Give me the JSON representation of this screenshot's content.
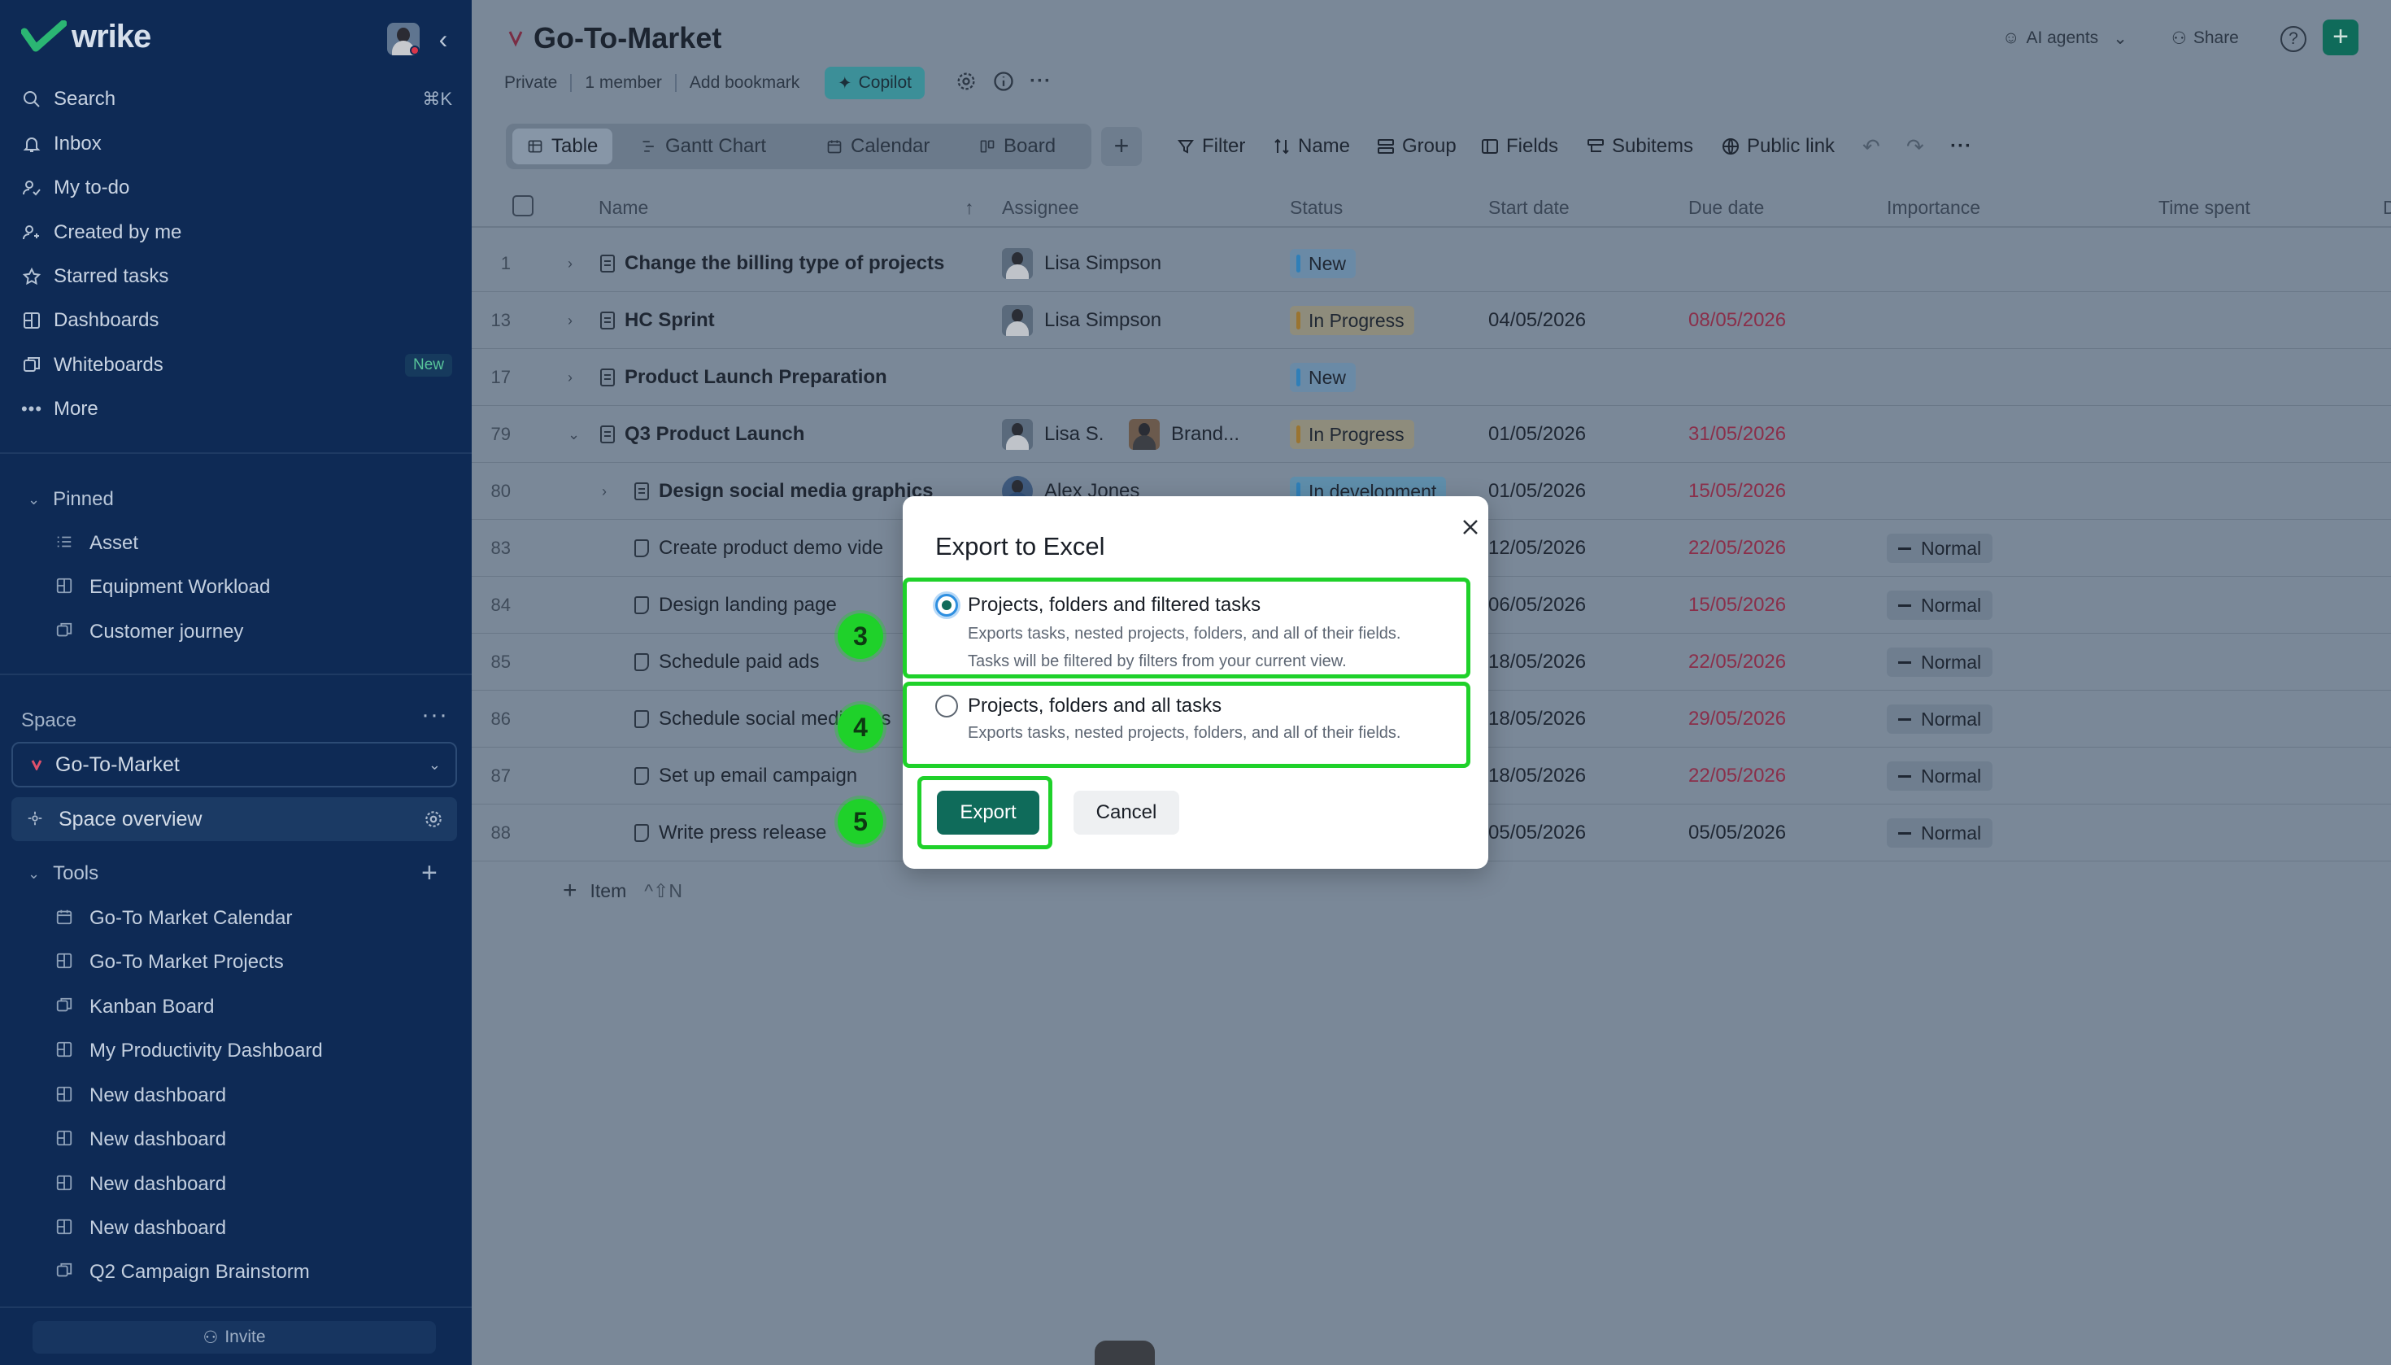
{
  "sidebar": {
    "logo": "wrike",
    "nav": [
      {
        "label": "Search",
        "shortcut": "⌘K",
        "icon": "search-icon"
      },
      {
        "label": "Inbox",
        "icon": "bell-icon"
      },
      {
        "label": "My to-do",
        "icon": "user-check-icon"
      },
      {
        "label": "Created by me",
        "icon": "user-plus-icon"
      },
      {
        "label": "Starred tasks",
        "icon": "star-icon"
      },
      {
        "label": "Dashboards",
        "icon": "dashboard-icon"
      },
      {
        "label": "Whiteboards",
        "badge": "New",
        "icon": "whiteboard-icon"
      },
      {
        "label": "More",
        "icon": "more-icon"
      }
    ],
    "pinned": {
      "label": "Pinned",
      "items": [
        {
          "label": "Asset",
          "icon": "list-icon"
        },
        {
          "label": "Equipment Workload",
          "icon": "dashboard-icon"
        },
        {
          "label": "Customer journey",
          "icon": "whiteboard-icon"
        }
      ]
    },
    "space": {
      "label": "Space",
      "selected": "Go-To-Market",
      "overview": "Space overview"
    },
    "tools": {
      "label": "Tools",
      "items": [
        {
          "label": "Go-To Market Calendar",
          "icon": "calendar-icon"
        },
        {
          "label": "Go-To Market Projects",
          "icon": "dashboard-icon"
        },
        {
          "label": "Kanban Board",
          "icon": "whiteboard-icon"
        },
        {
          "label": "My Productivity Dashboard",
          "icon": "dashboard-icon"
        },
        {
          "label": "New dashboard",
          "icon": "dashboard-icon"
        },
        {
          "label": "New dashboard",
          "icon": "dashboard-icon"
        },
        {
          "label": "New dashboard",
          "icon": "dashboard-icon"
        },
        {
          "label": "New dashboard",
          "icon": "dashboard-icon"
        },
        {
          "label": "Q2 Campaign Brainstorm",
          "icon": "whiteboard-icon"
        }
      ]
    },
    "invite": "Invite"
  },
  "header": {
    "title": "Go-To-Market",
    "meta": {
      "privacy": "Private",
      "members": "1 member",
      "bookmark": "Add bookmark"
    },
    "copilot": "Copilot",
    "ai_agents": "AI agents",
    "share": "Share",
    "help": "?"
  },
  "views": {
    "tabs": [
      "Table",
      "Gantt Chart",
      "Calendar",
      "Board"
    ],
    "active": "Table",
    "toolbar": {
      "filter": "Filter",
      "sort": "Name",
      "group": "Group",
      "fields": "Fields",
      "subitems": "Subitems",
      "public_link": "Public link"
    }
  },
  "table": {
    "columns": [
      "Name",
      "Assignee",
      "Status",
      "Start date",
      "Due date",
      "Importance",
      "Time spent",
      "D"
    ],
    "rows": [
      {
        "num": "1",
        "name": "Change the billing type of projects",
        "assignee": "Lisa Simpson",
        "status": "New",
        "start": "",
        "due": "",
        "importance": ""
      },
      {
        "num": "13",
        "name": "HC Sprint",
        "assignee": "Lisa Simpson",
        "status": "In Progress",
        "start": "04/05/2026",
        "due": "08/05/2026",
        "importance": ""
      },
      {
        "num": "17",
        "name": "Product Launch Preparation",
        "assignee": "",
        "status": "New",
        "start": "",
        "due": "",
        "importance": ""
      },
      {
        "num": "79",
        "name": "Q3 Product Launch",
        "assignee": "Lisa S.",
        "assignee2": "Brand...",
        "status": "In Progress",
        "start": "01/05/2026",
        "due": "31/05/2026",
        "importance": ""
      },
      {
        "num": "80",
        "name": "Design social media graphics",
        "assignee": "Alex Jones",
        "status": "In development",
        "start": "01/05/2026",
        "due": "15/05/2026",
        "importance": ""
      },
      {
        "num": "83",
        "name": "Create product demo vide",
        "start": "12/05/2026",
        "due": "22/05/2026",
        "importance": "Normal"
      },
      {
        "num": "84",
        "name": "Design landing page",
        "start": "06/05/2026",
        "due": "15/05/2026",
        "importance": "Normal"
      },
      {
        "num": "85",
        "name": "Schedule paid ads",
        "start": "18/05/2026",
        "due": "22/05/2026",
        "importance": "Normal"
      },
      {
        "num": "86",
        "name": "Schedule social media pos",
        "start": "18/05/2026",
        "due": "29/05/2026",
        "importance": "Normal"
      },
      {
        "num": "87",
        "name": "Set up email campaign",
        "start": "18/05/2026",
        "due": "22/05/2026",
        "importance": "Normal"
      },
      {
        "num": "88",
        "name": "Write press release",
        "start": "05/05/2026",
        "due": "05/05/2026",
        "importance": "Normal"
      }
    ],
    "add_item": "Item",
    "add_item_shortcut": "^⇧N"
  },
  "modal": {
    "title": "Export to Excel",
    "options": [
      {
        "title": "Projects, folders and filtered tasks",
        "desc1": "Exports tasks, nested projects, folders, and all of their fields.",
        "desc2": "Tasks will be filtered by filters from your current view.",
        "selected": true
      },
      {
        "title": "Projects, folders and all tasks",
        "desc1": "Exports tasks, nested projects, folders, and all of their fields.",
        "selected": false
      }
    ],
    "export": "Export",
    "cancel": "Cancel"
  },
  "annotations": [
    "3",
    "4",
    "5"
  ],
  "colors": {
    "accent": "#0f6b5a",
    "highlight": "#1fd12a",
    "sidebar": "#0e2a55",
    "due_overdue": "#8a2f4a"
  }
}
